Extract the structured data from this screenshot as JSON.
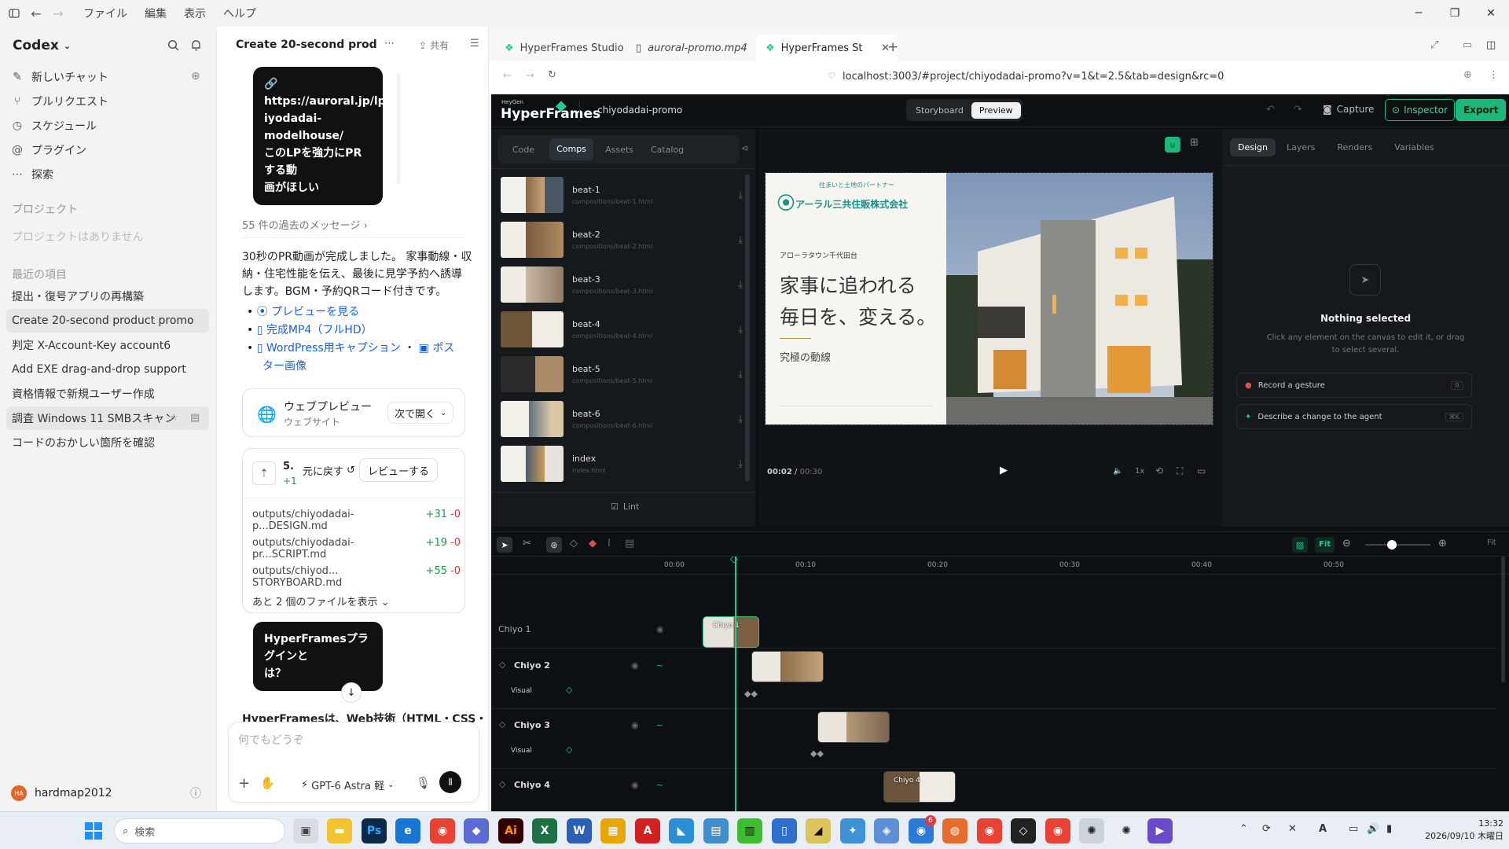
{
  "menu": {
    "file": "ファイル",
    "edit": "編集",
    "view": "表示",
    "help": "ヘルプ"
  },
  "sidebar": {
    "app_name": "Codex",
    "nav": [
      {
        "label": "新しいチャット",
        "icon": "new-chat-icon"
      },
      {
        "label": "プルリクエスト",
        "icon": "pull-request-icon"
      },
      {
        "label": "スケジュール",
        "icon": "clock-icon"
      },
      {
        "label": "プラグイン",
        "icon": "plugin-icon"
      },
      {
        "label": "探索",
        "icon": "more-icon"
      }
    ],
    "projects_heading": "プロジェクト",
    "projects_empty": "プロジェクトはありません",
    "recent_heading": "最近の項目",
    "recent": [
      "提出・復号アプリの再構築",
      "Create 20-second product promo",
      "判定 X-Account-Key account6",
      "Add EXE drag-and-drop support",
      "資格情報で新規ユーザー作成",
      "調査 Windows 11 SMBスキャン",
      "コードのおかしい箇所を確認"
    ],
    "user": {
      "initials": "HA",
      "name": "hardmap2012"
    }
  },
  "chat": {
    "title": "Create 20-second product pr",
    "share": "共有",
    "user_msg_1": [
      "🔗 https://auroral.jp/lp/ch",
      "iyodadai-modelhouse/",
      "このLPを強力にPRする動",
      "画がほしい"
    ],
    "past_messages": "55 件の過去のメッセージ",
    "reply_1": [
      "30秒のPR動画が完成しました。 家事動線・収",
      "納・住宅性能を伝え、最後に見学予約へ誘導",
      "します。BGM・予約QRコード付きです。"
    ],
    "links": [
      "プレビューを見る",
      "完成MP4（フルHD）",
      "WordPress用キャプション",
      "ポス",
      "ター画像"
    ],
    "web_preview": {
      "title": "ウェブプレビュー",
      "subtitle": "ウェブサイト",
      "open_label": "次で開く"
    },
    "changes": {
      "count": "5.",
      "plus": "+1",
      "undo": "元に戻す",
      "review": "レビューする"
    },
    "files": [
      {
        "name": "outputs/chiyodadai-p...DESIGN.md",
        "add": "+31",
        "del": "-0"
      },
      {
        "name": "outputs/chiyodadai-pr...SCRIPT.md",
        "add": "+19",
        "del": "-0"
      },
      {
        "name": "outputs/chiyod... STORYBOARD.md",
        "add": "+55",
        "del": "-0"
      }
    ],
    "more_files": "あと 2 個のファイルを表示",
    "user_msg_2": [
      "HyperFramesプラグインと",
      "は？"
    ],
    "reply_2": "HyperFramesは、Web技術（HTML・CSS・",
    "input_placeholder": "何でもどうぞ",
    "model": "GPT-6 Astra 軽"
  },
  "browser": {
    "tabs": [
      {
        "label": "HyperFrames Studio"
      },
      {
        "label": "auroral-promo.mp4"
      },
      {
        "label": "HyperFrames St"
      }
    ],
    "url": "localhost:3003/#project/chiyodadai-promo?v=1&t=2.5&tab=design&rc=0"
  },
  "app": {
    "brand_top": "HeyGen",
    "brand": "HyperFrames",
    "project": "chiyodadai-promo",
    "view_tabs": [
      "Storyboard",
      "Preview"
    ],
    "capture": "Capture",
    "inspector": "Inspector",
    "export": "Export",
    "left_tabs": [
      "Code",
      "Comps",
      "Assets",
      "Catalog"
    ],
    "comps": [
      {
        "name": "beat-1",
        "path": "compositions/beat-1.html"
      },
      {
        "name": "beat-2",
        "path": "compositions/beat-2.html"
      },
      {
        "name": "beat-3",
        "path": "compositions/beat-3.html"
      },
      {
        "name": "beat-4",
        "path": "compositions/beat-4.html"
      },
      {
        "name": "beat-5",
        "path": "compositions/beat-5.html"
      },
      {
        "name": "beat-6",
        "path": "compositions/beat-6.html"
      },
      {
        "name": "index",
        "path": "index.html"
      }
    ],
    "lint": "Lint",
    "preview": {
      "tagline": "住まいと土地のパートナー",
      "company": "アーラル三共住販株式会社",
      "logo_mark": "アーラル",
      "town": "アローラタウン千代田台",
      "headline_1": "家事に追われる",
      "headline_2": "毎日を、変える。",
      "sub": "究極の動線"
    },
    "time_current": "00:02",
    "time_total": "00:30",
    "speed": "1x",
    "right_tabs": [
      "Design",
      "Layers",
      "Renders",
      "Variables"
    ],
    "nothing_selected": "Nothing selected",
    "nothing_hint_1": "Click any element on the canvas to edit it, or drag",
    "nothing_hint_2": "to select several.",
    "actions": [
      {
        "label": "Record a gesture",
        "key": "R"
      },
      {
        "label": "Describe a change to the agent",
        "key": "⌘K"
      }
    ],
    "timeline": {
      "fit": "Fit",
      "fit2": "Fit",
      "ruler": [
        "00:00",
        "00:10",
        "00:20",
        "00:30",
        "00:40",
        "00:50"
      ],
      "tracks": [
        {
          "name": "Chiyo 1",
          "sub": ""
        },
        {
          "name": "Chiyo 2",
          "sub": "Visual"
        },
        {
          "name": "Chiyo 3",
          "sub": "Visual"
        },
        {
          "name": "Chiyo 4",
          "sub": ""
        }
      ],
      "clip_label_1": "Chiyo 1",
      "clip_label_4": "Chiyo 4"
    }
  },
  "taskbar": {
    "search_placeholder": "検索",
    "time": "13:32",
    "date": "2026/09/10 木曜日",
    "badge": "6"
  },
  "colors": {
    "accent_green": "#20c997",
    "export_green": "#1db87a",
    "dark_bg": "#0d1013"
  }
}
